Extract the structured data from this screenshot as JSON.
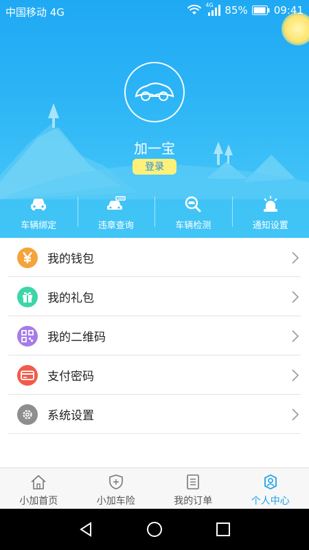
{
  "status_bar": {
    "carrier": "中国移动 4G",
    "net_small": "4G",
    "battery": "85%",
    "time": "09:41"
  },
  "profile": {
    "avatar_text": "加一宝",
    "username": "加一宝",
    "login_label": "登录"
  },
  "quick_actions": [
    {
      "label": "车辆绑定",
      "icon": "car-icon"
    },
    {
      "label": "违章查询",
      "icon": "traffic-camera-icon"
    },
    {
      "label": "车辆检测",
      "icon": "inspect-icon"
    },
    {
      "label": "通知设置",
      "icon": "alarm-light-icon"
    }
  ],
  "menu": [
    {
      "label": "我的钱包",
      "icon": "yen-icon",
      "color": "#f5a33b"
    },
    {
      "label": "我的礼包",
      "icon": "gift-icon",
      "color": "#3dd6a9"
    },
    {
      "label": "我的二维码",
      "icon": "qrcode-icon",
      "color": "#a67ce8"
    },
    {
      "label": "支付密码",
      "icon": "card-icon",
      "color": "#f25b4a"
    },
    {
      "label": "系统设置",
      "icon": "gear-icon",
      "color": "#8e8e8e"
    }
  ],
  "tabs": [
    {
      "label": "小加首页",
      "icon": "home-icon",
      "active": false
    },
    {
      "label": "小加车险",
      "icon": "shield-icon",
      "active": false
    },
    {
      "label": "我的订单",
      "icon": "order-icon",
      "active": false
    },
    {
      "label": "个人中心",
      "icon": "person-icon",
      "active": true
    }
  ],
  "colors": {
    "header_blue": "#1fa9f3",
    "active_tab": "#1aa2e8",
    "login_button": "#fff07a"
  }
}
